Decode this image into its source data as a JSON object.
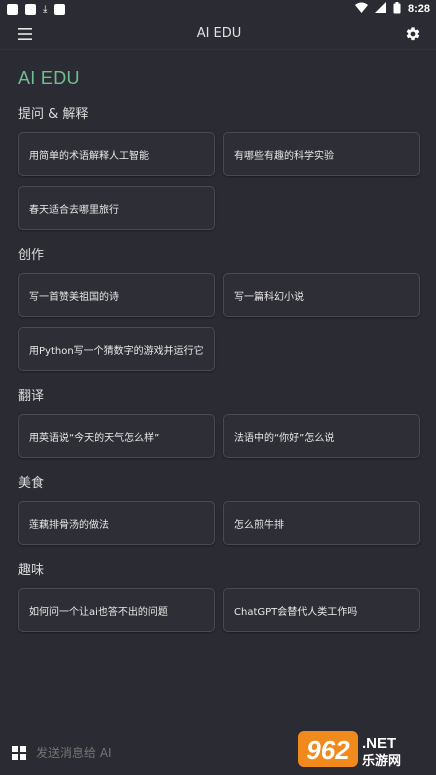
{
  "status_bar": {
    "time": "8:28"
  },
  "app_bar": {
    "title": "AI EDU"
  },
  "brand": "AI EDU",
  "sections": [
    {
      "title": "提问 & 解释",
      "items": [
        "用简单的术语解释人工智能",
        "有哪些有趣的科学实验",
        "春天适合去哪里旅行"
      ]
    },
    {
      "title": "创作",
      "items": [
        "写一首赞美祖国的诗",
        "写一篇科幻小说",
        "用Python写一个猜数字的游戏并运行它"
      ]
    },
    {
      "title": "翻译",
      "items": [
        "用英语说“今天的天气怎么样”",
        "法语中的“你好”怎么说"
      ]
    },
    {
      "title": "美食",
      "items": [
        "莲藕排骨汤的做法",
        "怎么煎牛排"
      ]
    },
    {
      "title": "趣味",
      "items": [
        "如何问一个让ai也答不出的问题",
        "ChatGPT会替代人类工作吗"
      ]
    }
  ],
  "input": {
    "placeholder": "发送消息给 AI"
  },
  "watermark": {
    "number": "962",
    "suffix": ".NET",
    "text": "乐游网"
  },
  "colors": {
    "background": "#2b2b33",
    "brand": "#6fbf8f",
    "card_border": "#4a4a53"
  }
}
